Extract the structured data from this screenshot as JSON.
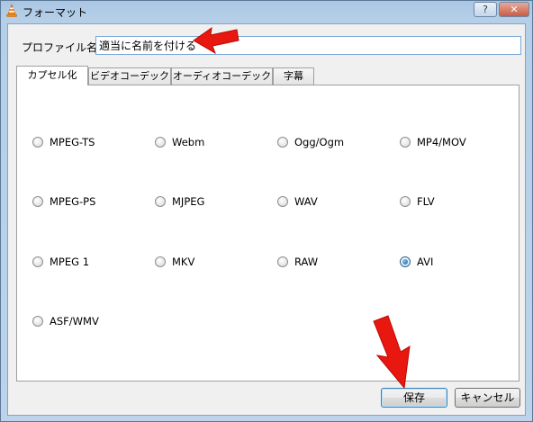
{
  "window": {
    "title": "フォーマット",
    "help_label": "?",
    "close_label": "✕"
  },
  "profile": {
    "label": "プロファイル名",
    "value": "適当に名前を付ける"
  },
  "tabs": [
    {
      "label": "カプセル化",
      "active": true
    },
    {
      "label": "ビデオコーデック",
      "active": false
    },
    {
      "label": "オーディオコーデック",
      "active": false
    },
    {
      "label": "字幕",
      "active": false
    }
  ],
  "options": [
    {
      "label": "MPEG-TS",
      "checked": false
    },
    {
      "label": "Webm",
      "checked": false
    },
    {
      "label": "Ogg/Ogm",
      "checked": false
    },
    {
      "label": "MP4/MOV",
      "checked": false
    },
    {
      "label": "MPEG-PS",
      "checked": false
    },
    {
      "label": "MJPEG",
      "checked": false
    },
    {
      "label": "WAV",
      "checked": false
    },
    {
      "label": "FLV",
      "checked": false
    },
    {
      "label": "MPEG 1",
      "checked": false
    },
    {
      "label": "MKV",
      "checked": false
    },
    {
      "label": "RAW",
      "checked": false
    },
    {
      "label": "AVI",
      "checked": true
    },
    {
      "label": "ASF/WMV",
      "checked": false
    }
  ],
  "buttons": {
    "save": "保存",
    "cancel": "キャンセル"
  },
  "colors": {
    "annotation_arrow": "#e8170f",
    "accent": "#3c7fb1"
  },
  "icons": {
    "app": "vlc-cone-icon",
    "arrow": "red-pointer-arrow-icon"
  }
}
